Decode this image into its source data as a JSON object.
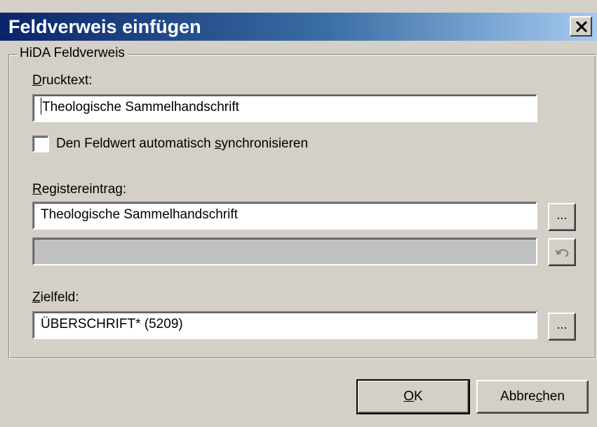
{
  "window": {
    "title": "Feldverweis einfügen",
    "close_label": "×"
  },
  "group": {
    "title": "HiDA Feldverweis"
  },
  "drucktext": {
    "label_acc": "D",
    "label_rest": "rucktext:",
    "value": "Theologische Sammelhandschrift"
  },
  "sync_checkbox": {
    "label_pre": "Den Feldwert automatisch ",
    "label_acc": "s",
    "label_post": "ynchronisieren",
    "checked": false
  },
  "registereintrag": {
    "label_acc": "R",
    "label_rest": "egistereintrag:",
    "value": "Theologische Sammelhandschrift",
    "secondary_value": "",
    "browse_label": "...",
    "undo_icon": "undo-icon"
  },
  "zielfeld": {
    "label_acc": "Z",
    "label_rest": "ielfeld:",
    "value": "ÜBERSCHRIFT* (5209)",
    "browse_label": "..."
  },
  "buttons": {
    "ok_acc": "O",
    "ok_rest": "K",
    "cancel_pre": "Abbre",
    "cancel_acc": "c",
    "cancel_post": "hen"
  }
}
